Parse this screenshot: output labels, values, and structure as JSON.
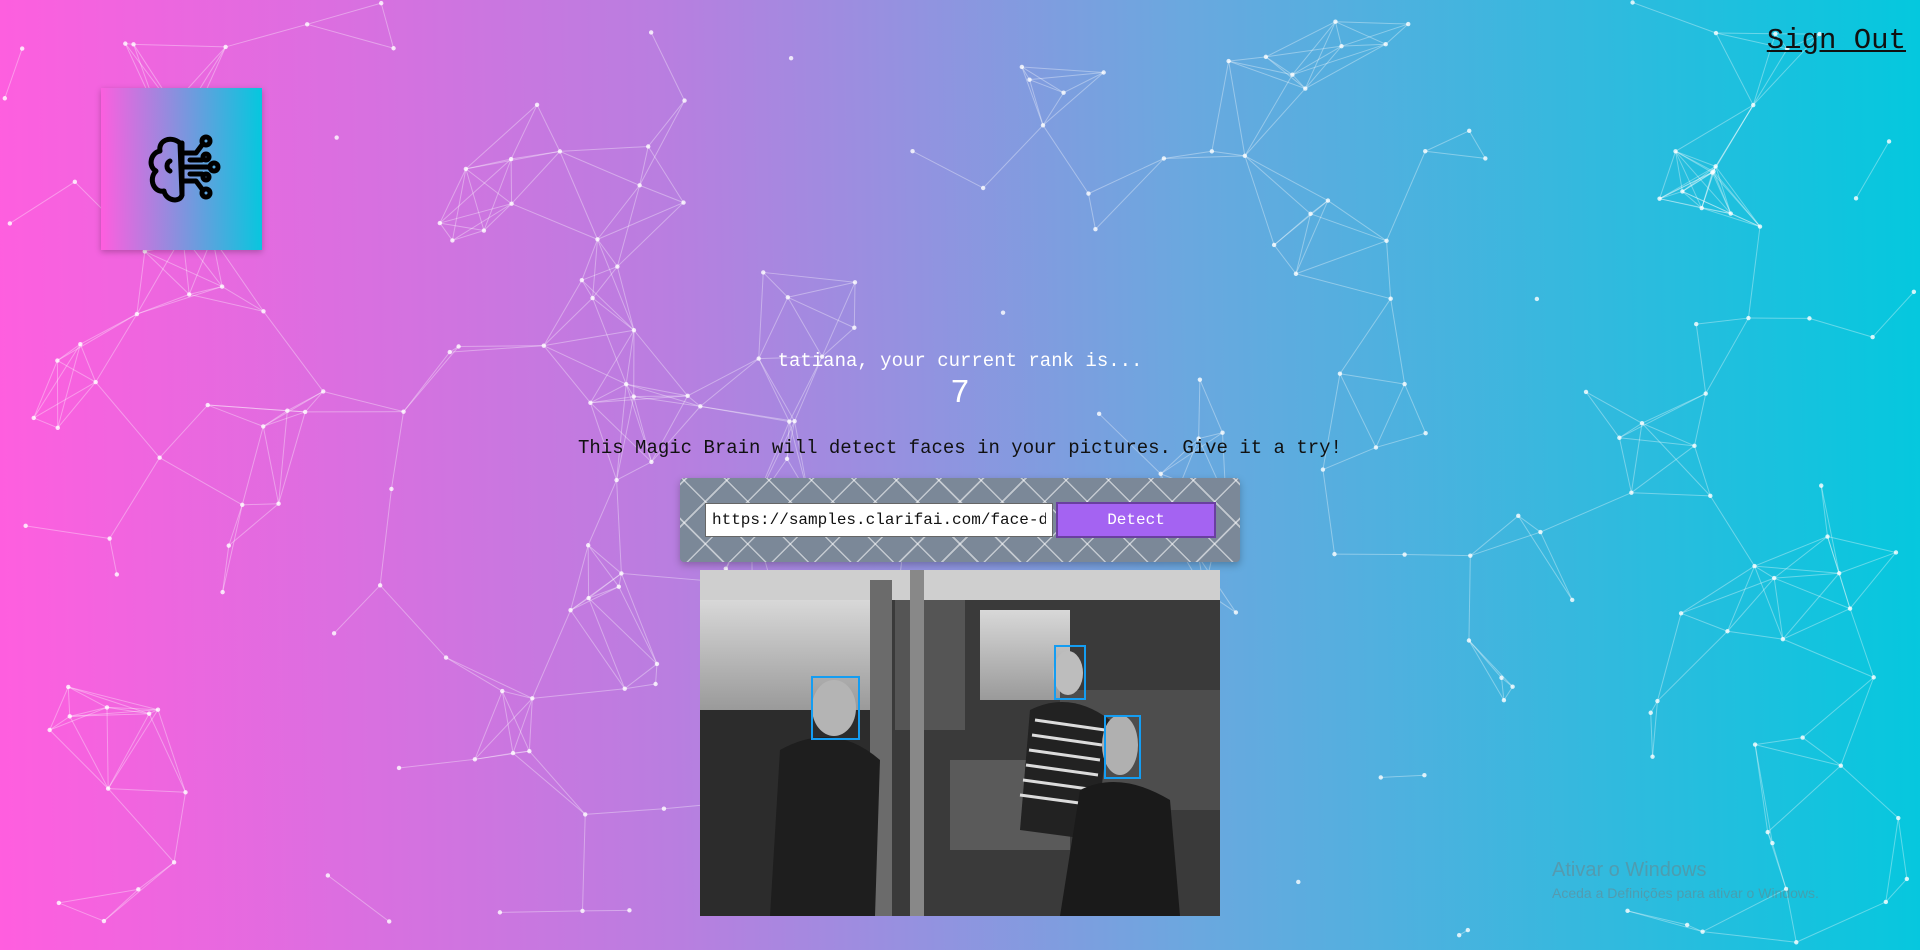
{
  "nav": {
    "signout_label": "Sign Out"
  },
  "logo": {
    "icon": "brain-circuit-icon"
  },
  "rank": {
    "label": "tatiana, your current rank is...",
    "value": "7"
  },
  "intro": {
    "text": "This Magic Brain will detect faces in your pictures. Give it a try!"
  },
  "form": {
    "input_value": "https://samples.clarifai.com/face-det.jpg",
    "button_label": "Detect"
  },
  "result": {
    "faces_detected": 3
  },
  "watermark": {
    "title": "Ativar o Windows",
    "subtitle": "Aceda a Definições para ativar o Windows."
  },
  "colors": {
    "gradient_start": "#ff5edf",
    "gradient_end": "#04c8de",
    "button": "#a463f2",
    "face_box": "#149df2"
  }
}
